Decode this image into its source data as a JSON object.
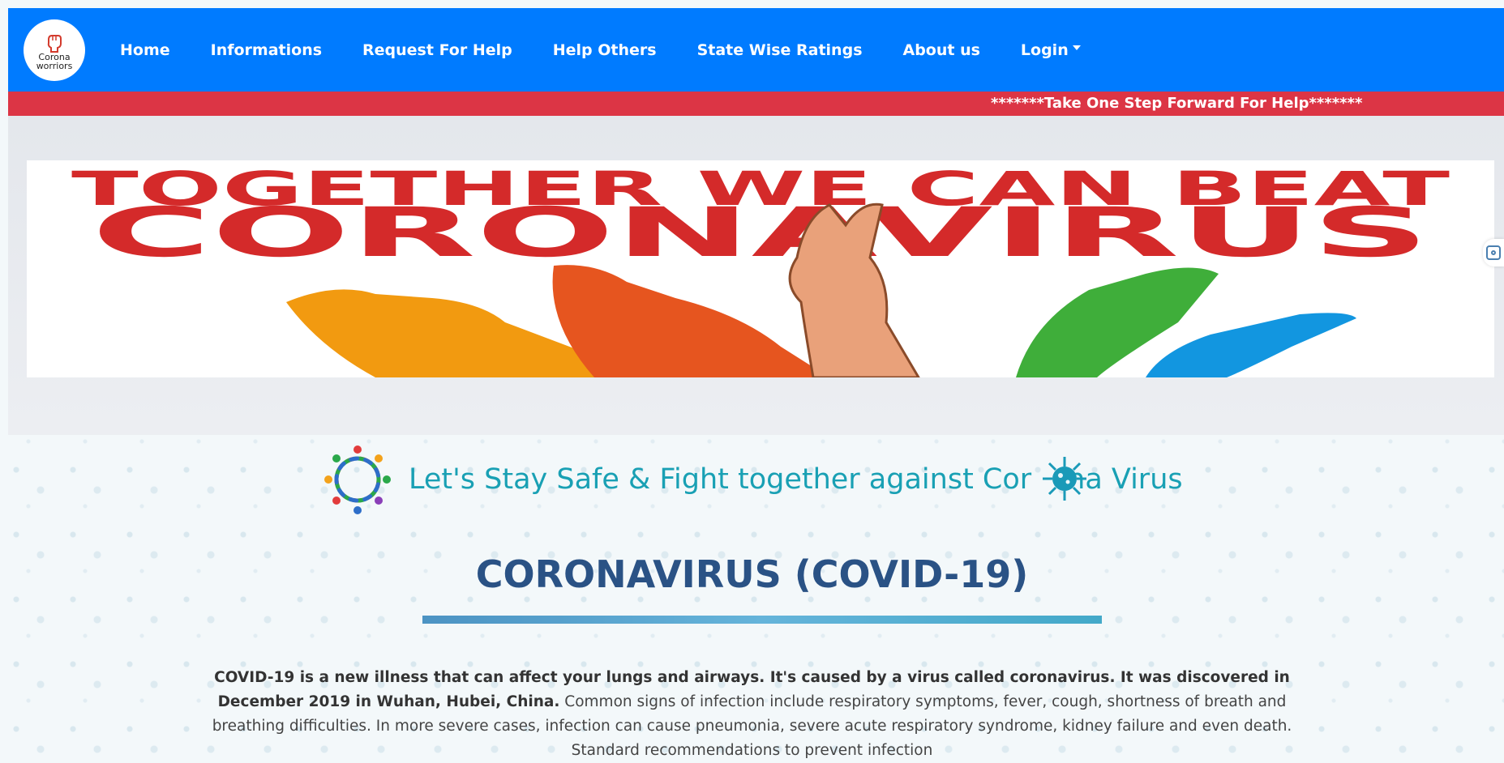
{
  "brand": {
    "logo_text_line1": "Corona",
    "logo_text_line2": "worriors"
  },
  "nav": {
    "items": [
      "Home",
      "Informations",
      "Request For Help",
      "Help Others",
      "State Wise Ratings",
      "About us"
    ],
    "login_label": "Login"
  },
  "ticker": {
    "text": "*******Take One Step Forward For Help*******"
  },
  "banner": {
    "line1": "TOGETHER WE CAN BEAT",
    "line2": "CORONAVIRUS"
  },
  "motto": {
    "text_before": "Let's Stay Safe & Fight together against Cor",
    "text_after": "na Virus"
  },
  "section": {
    "title": "CORONAVIRUS (COVID-19)",
    "intro_bold": "COVID-19 is a new illness that can affect your lungs and airways. It's caused by a virus called coronavirus. It was discovered in December 2019 in Wuhan, Hubei, China.",
    "intro_rest": " Common signs of infection include respiratory symptoms, fever, cough, shortness of breath and breathing difficulties. In more severe cases, infection can cause pneumonia, severe acute respiratory syndrome, kidney failure and even death. Standard recommendations to prevent infection"
  },
  "colors": {
    "navbar": "#007bff",
    "ticker": "#dc3545",
    "motto": "#19a0b4",
    "title": "#2a5285"
  }
}
